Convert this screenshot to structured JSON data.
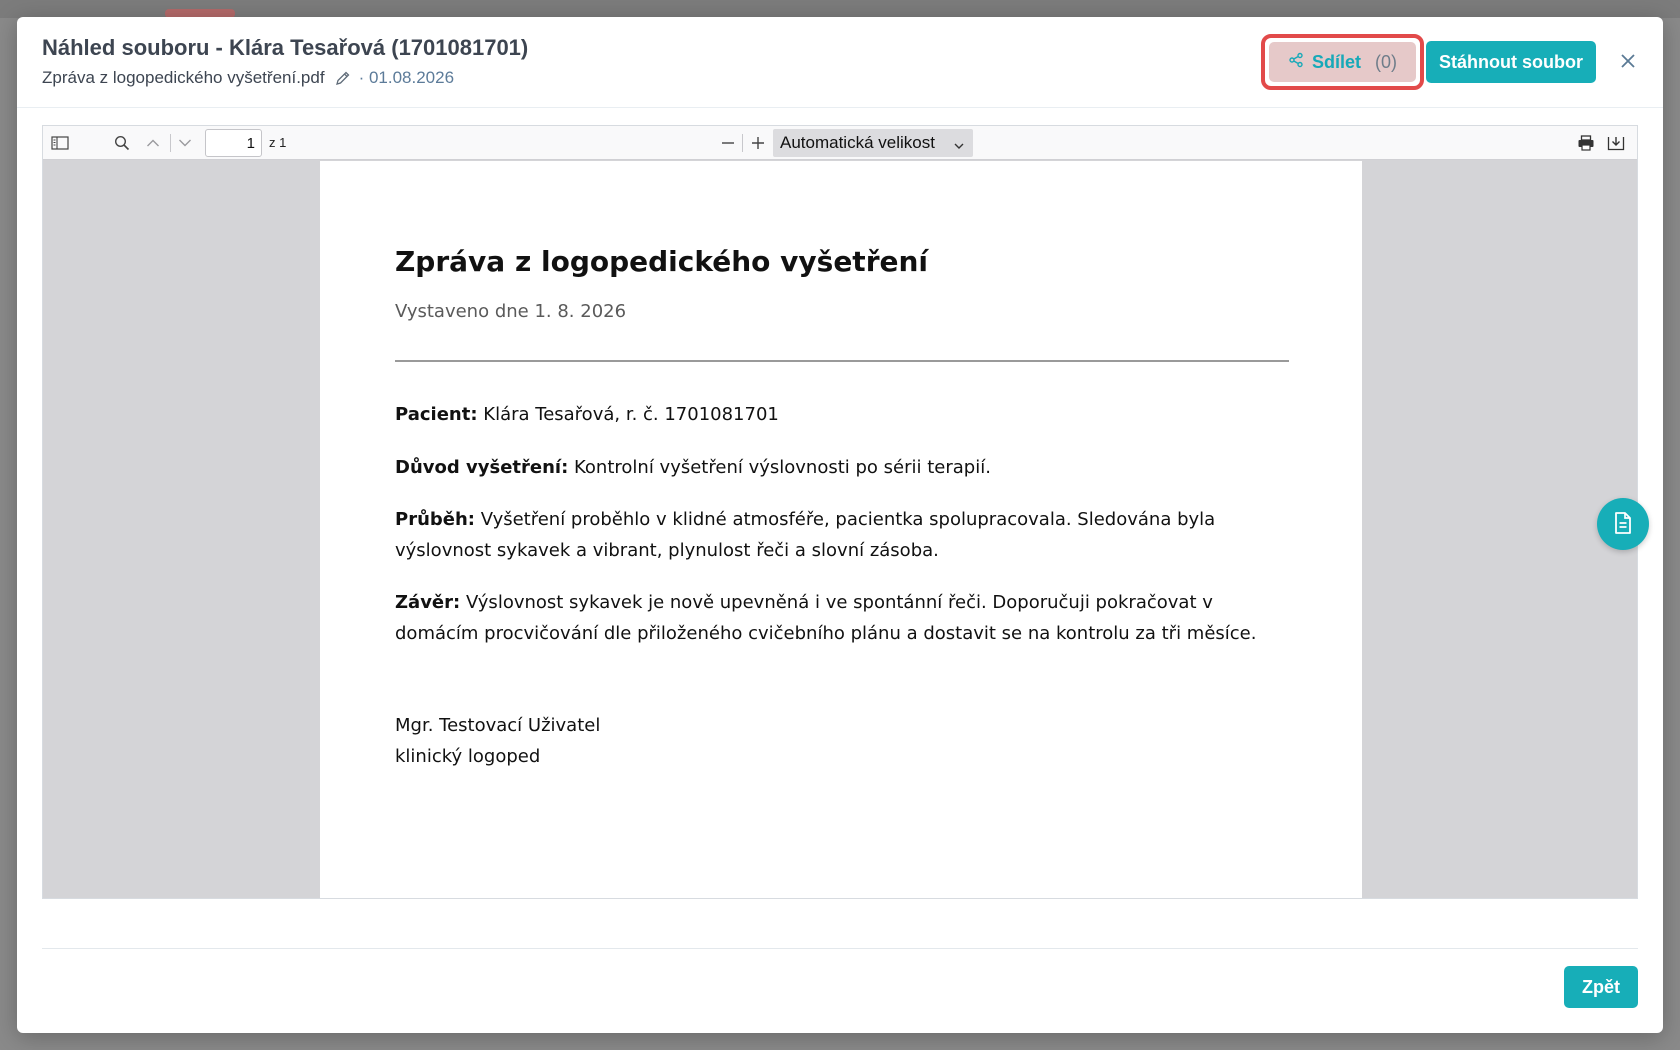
{
  "modal": {
    "title": "Náhled souboru - Klára Tesařová (1701081701)",
    "filename": "Zpráva z logopedického vyšetření.pdf",
    "date": "· 01.08.2026",
    "share_label": "Sdílet",
    "share_count": "(0)",
    "download_label": "Stáhnout soubor",
    "back_label": "Zpět"
  },
  "viewer": {
    "page_value": "1",
    "page_of": "z 1",
    "zoom_label": "Automatická velikost"
  },
  "document": {
    "title": "Zpráva z logopedického vyšetření",
    "issued": "Vystaveno dne 1. 8. 2026",
    "patient_label": "Pacient:",
    "patient_value": "Klára Tesařová, r. č. 1701081701",
    "reason_label": "Důvod vyšetření:",
    "reason_value": "Kontrolní vyšetření výslovnosti po sérii terapií.",
    "course_label": "Průběh:",
    "course_value": "Vyšetření proběhlo v klidné atmosféře, pacientka spolupracovala. Sledována byla výslovnost sykavek a vibrant, plynulost řeči a slovní zásoba.",
    "conclusion_label": "Závěr:",
    "conclusion_value": "Výslovnost sykavek je nově upevněná i ve spontánní řeči. Doporučuji pokračovat v domácím procvičování dle přiloženého cvičebního plánu a dostavit se na kontrolu za tři měsíce.",
    "signature_name": "Mgr. Testovací Uživatel",
    "signature_role": "klinický logoped"
  },
  "colors": {
    "accent": "#17aeb8",
    "highlight": "#e24a4a",
    "text": "#3d4551"
  },
  "icons": {
    "share": "share-icon",
    "edit": "pencil-icon",
    "close": "close-icon",
    "sidebar": "sidebar-toggle-icon",
    "search": "search-icon",
    "prev": "chevron-up-icon",
    "next": "chevron-down-icon",
    "zoom_out": "minus-icon",
    "zoom_in": "plus-icon",
    "print": "printer-icon",
    "save": "download-icon",
    "document": "document-icon"
  }
}
